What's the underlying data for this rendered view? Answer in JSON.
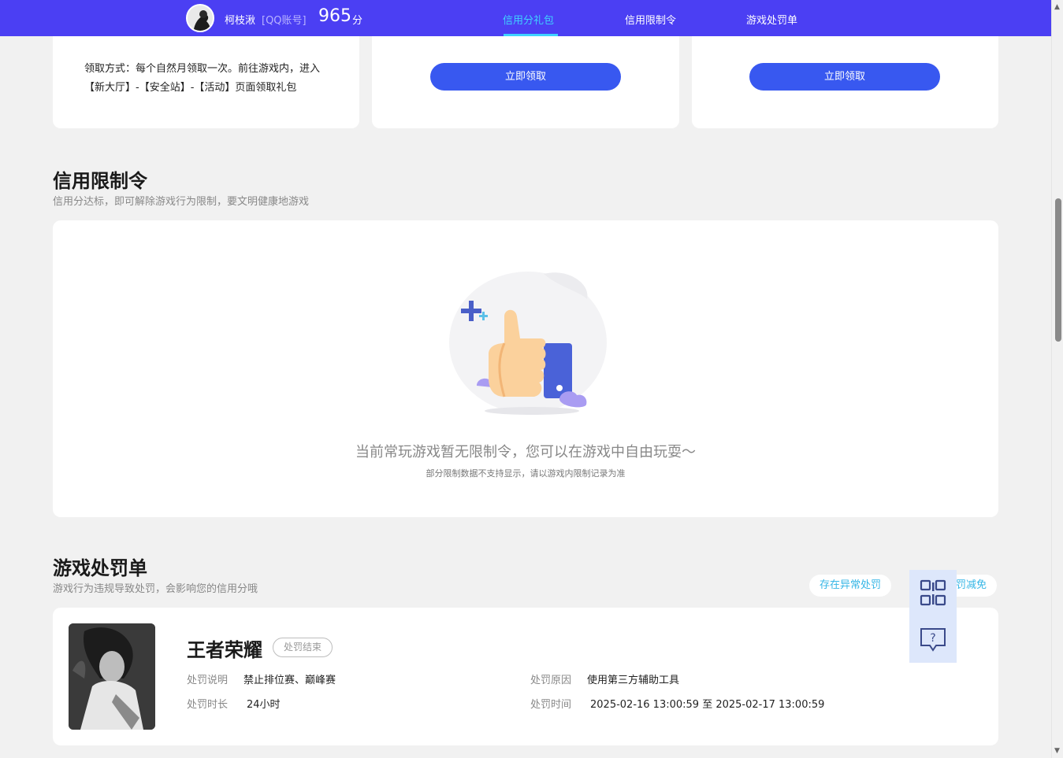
{
  "header": {
    "username": "柯枝湫",
    "account_type": "[QQ账号]",
    "score": "965",
    "score_unit": "分",
    "nav": [
      {
        "label": "信用分礼包",
        "active": true
      },
      {
        "label": "信用限制令",
        "active": false
      },
      {
        "label": "游戏处罚单",
        "active": false
      }
    ]
  },
  "gift_section": {
    "note": "领取方式：每个自然月领取一次。前往游戏内，进入【新大厅】-【安全站】-【活动】页面领取礼包",
    "claim_label_1": "立即领取",
    "claim_label_2": "立即领取"
  },
  "restriction_section": {
    "title": "信用限制令",
    "subtitle": "信用分达标，即可解除游戏行为限制，要文明健康地游戏",
    "empty_message": "当前常玩游戏暂无限制令，您可以在游戏中自由玩耍～",
    "empty_note": "部分限制数据不支持显示，请以游戏内限制记录为准"
  },
  "penalty_section": {
    "title": "游戏处罚单",
    "subtitle": "游戏行为违规导致处罚，会影响您的信用分哦",
    "abnormal_label": "存在异常处罚",
    "reduce_label": "罚减免",
    "record": {
      "game_name": "王者荣耀",
      "status": "处罚结束",
      "desc_label": "处罚说明",
      "desc_value": "禁止排位赛、巅峰赛",
      "duration_label": "处罚时长",
      "duration_value": "24小时",
      "reason_label": "处罚原因",
      "reason_value": "使用第三方辅助工具",
      "time_label": "处罚时间",
      "time_value": "2025-02-16 13:00:59 至 2025-02-17 13:00:59"
    }
  },
  "float_panel": {
    "icons": [
      "qr-code-icon",
      "help-chat-icon"
    ]
  },
  "colors": {
    "nav_bg": "#4b3ff3",
    "nav_active": "#3fd2ff",
    "button": "#3858f0",
    "link": "#36b6e6"
  }
}
